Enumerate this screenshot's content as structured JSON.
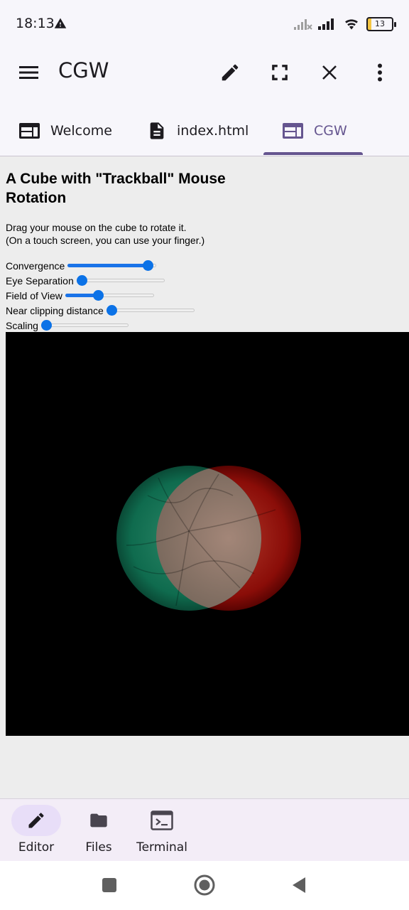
{
  "status": {
    "time": "18:13",
    "battery": "13",
    "icons": [
      "alert-icon",
      "signal-no-service-icon",
      "signal-icon",
      "wifi-icon",
      "battery-icon"
    ]
  },
  "appbar": {
    "title": "CGW",
    "icons": [
      "menu-icon",
      "edit-icon",
      "fullscreen-icon",
      "close-icon",
      "more-vert-icon"
    ]
  },
  "tabs": [
    {
      "label": "Welcome",
      "icon": "web-icon",
      "active": false
    },
    {
      "label": "index.html",
      "icon": "description-icon",
      "active": false
    },
    {
      "label": "CGW",
      "icon": "web-icon",
      "active": true
    }
  ],
  "page": {
    "heading": "A Cube with \"Trackball\" Mouse Rotation",
    "desc_line1": "Drag your mouse on the cube to rotate it.",
    "desc_line2": "(On a touch screen, you can use your finger.)",
    "controls": [
      {
        "label": "Convergence",
        "value": 0.95
      },
      {
        "label": "Eye Separation",
        "value": 0.0
      },
      {
        "label": "Field of View",
        "value": 0.35
      },
      {
        "label": "Near clipping distance",
        "value": 0.0
      },
      {
        "label": "Scaling",
        "value": 0.0
      }
    ]
  },
  "bottom_nav": [
    {
      "label": "Editor",
      "icon": "edit-icon",
      "active": true
    },
    {
      "label": "Files",
      "icon": "folder-icon",
      "active": false
    },
    {
      "label": "Terminal",
      "icon": "terminal-icon",
      "active": false
    }
  ],
  "system_nav": [
    "recents-icon",
    "home-icon",
    "back-icon"
  ],
  "colors": {
    "accent": "#65558f",
    "slider": "#0b72e7",
    "canvas": "#000000"
  }
}
